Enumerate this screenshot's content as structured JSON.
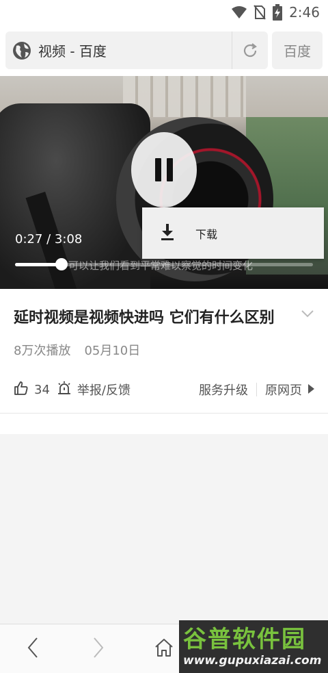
{
  "status_bar": {
    "time": "2:46",
    "icons": [
      "wifi-icon",
      "no-sim-icon",
      "battery-charging-icon"
    ]
  },
  "address_bar": {
    "title": "视频 - 百度",
    "search_label": "百度",
    "icons": [
      "globe-icon",
      "refresh-icon"
    ]
  },
  "video": {
    "time_display": "0:27 / 3:08",
    "progress_fraction": 0.155,
    "subtitle": "可以让我们看到平常难以察觉的时间变化",
    "state_icon": "pause-icon"
  },
  "popup_menu": {
    "items": [
      {
        "label": "下载",
        "icon": "download-icon"
      }
    ]
  },
  "info": {
    "title": "延时视频是视频快进吗 它们有什么区别",
    "plays": "8万次播放",
    "date": "05月10日",
    "likes": "34",
    "report_label": "举报/反馈",
    "upgrade_label": "服务升级",
    "source_label": "原网页",
    "icons": [
      "chevron-down-icon",
      "thumbs-up-icon",
      "report-icon",
      "play-arrow-icon"
    ]
  },
  "bottom_nav": {
    "icons": [
      "back-icon",
      "forward-icon",
      "home-icon"
    ]
  },
  "watermark": {
    "text_main": "谷普软件园",
    "text_url": "www.gupuxiazai.com"
  }
}
